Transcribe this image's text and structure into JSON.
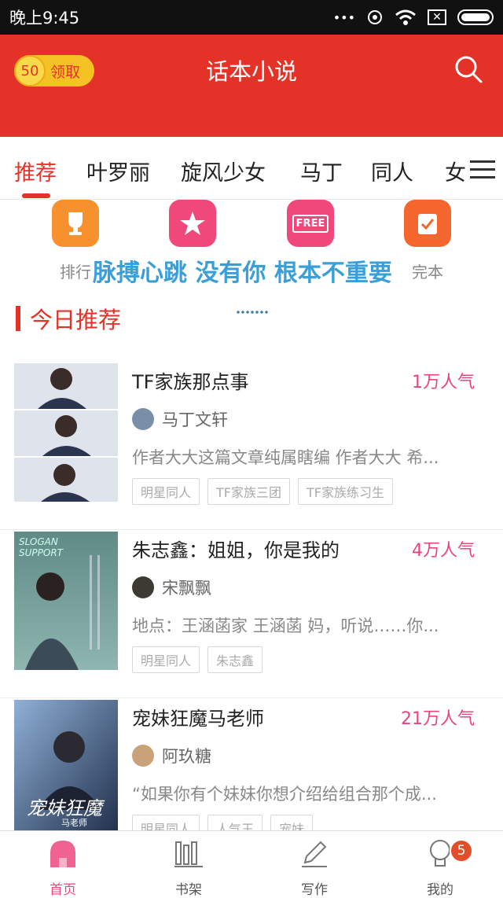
{
  "status_bar": {
    "time": "晚上9:45",
    "dots": "•••",
    "sim_label": "✕"
  },
  "header": {
    "coins": "50",
    "coin_label": "领取",
    "title": "话本小说"
  },
  "tabs": [
    "推荐",
    "叶罗丽",
    "旋风少女",
    "马丁",
    "同人",
    "女"
  ],
  "quick": [
    {
      "label": "排行",
      "icon": "trophy-icon",
      "color": "#f7912e"
    },
    {
      "label": "",
      "icon": "star-icon",
      "color": "#f0487a"
    },
    {
      "label": "",
      "icon": "free-icon",
      "color": "#f0487a",
      "badge_text": "FREE"
    },
    {
      "label": "完本",
      "icon": "check-icon",
      "color": "#f4662e"
    }
  ],
  "overlay": "脉搏心跳 没有你 根本不重要",
  "section": {
    "title": "今日推荐"
  },
  "books": [
    {
      "title": "TF家族那点事",
      "popularity": "1万人气",
      "author": "马丁文轩",
      "desc": "作者大大这篇文章纯属瞎编 作者大大 希...",
      "tags": [
        "明星同人",
        "TF家族三团",
        "TF家族练习生"
      ]
    },
    {
      "title": "朱志鑫：姐姐，你是我的",
      "popularity": "4万人气",
      "author": "宋飘飘",
      "desc": "地点：王涵菡家 王涵菡 妈，听说……你...",
      "tags": [
        "明星同人",
        "朱志鑫"
      ]
    },
    {
      "title": "宠妹狂魔马老师",
      "popularity": "21万人气",
      "author": "阿玖糖",
      "desc": "“如果你有个妹妹你想介绍给组合那个成...",
      "tags": [
        "明星同人",
        "人气王",
        "宠妹"
      ]
    }
  ],
  "cover_texts": {
    "book2_top": "SLOGAN SUPPORT",
    "book3_title": "宠妹狂魔",
    "book3_sub": "马老师"
  },
  "nav": [
    {
      "label": "首页"
    },
    {
      "label": "书架"
    },
    {
      "label": "写作"
    },
    {
      "label": "我的",
      "badge": "5"
    }
  ],
  "colors": {
    "brand_red": "#e53228",
    "accent_pink": "#e8467a",
    "overlay_blue": "#3a9fd9"
  }
}
